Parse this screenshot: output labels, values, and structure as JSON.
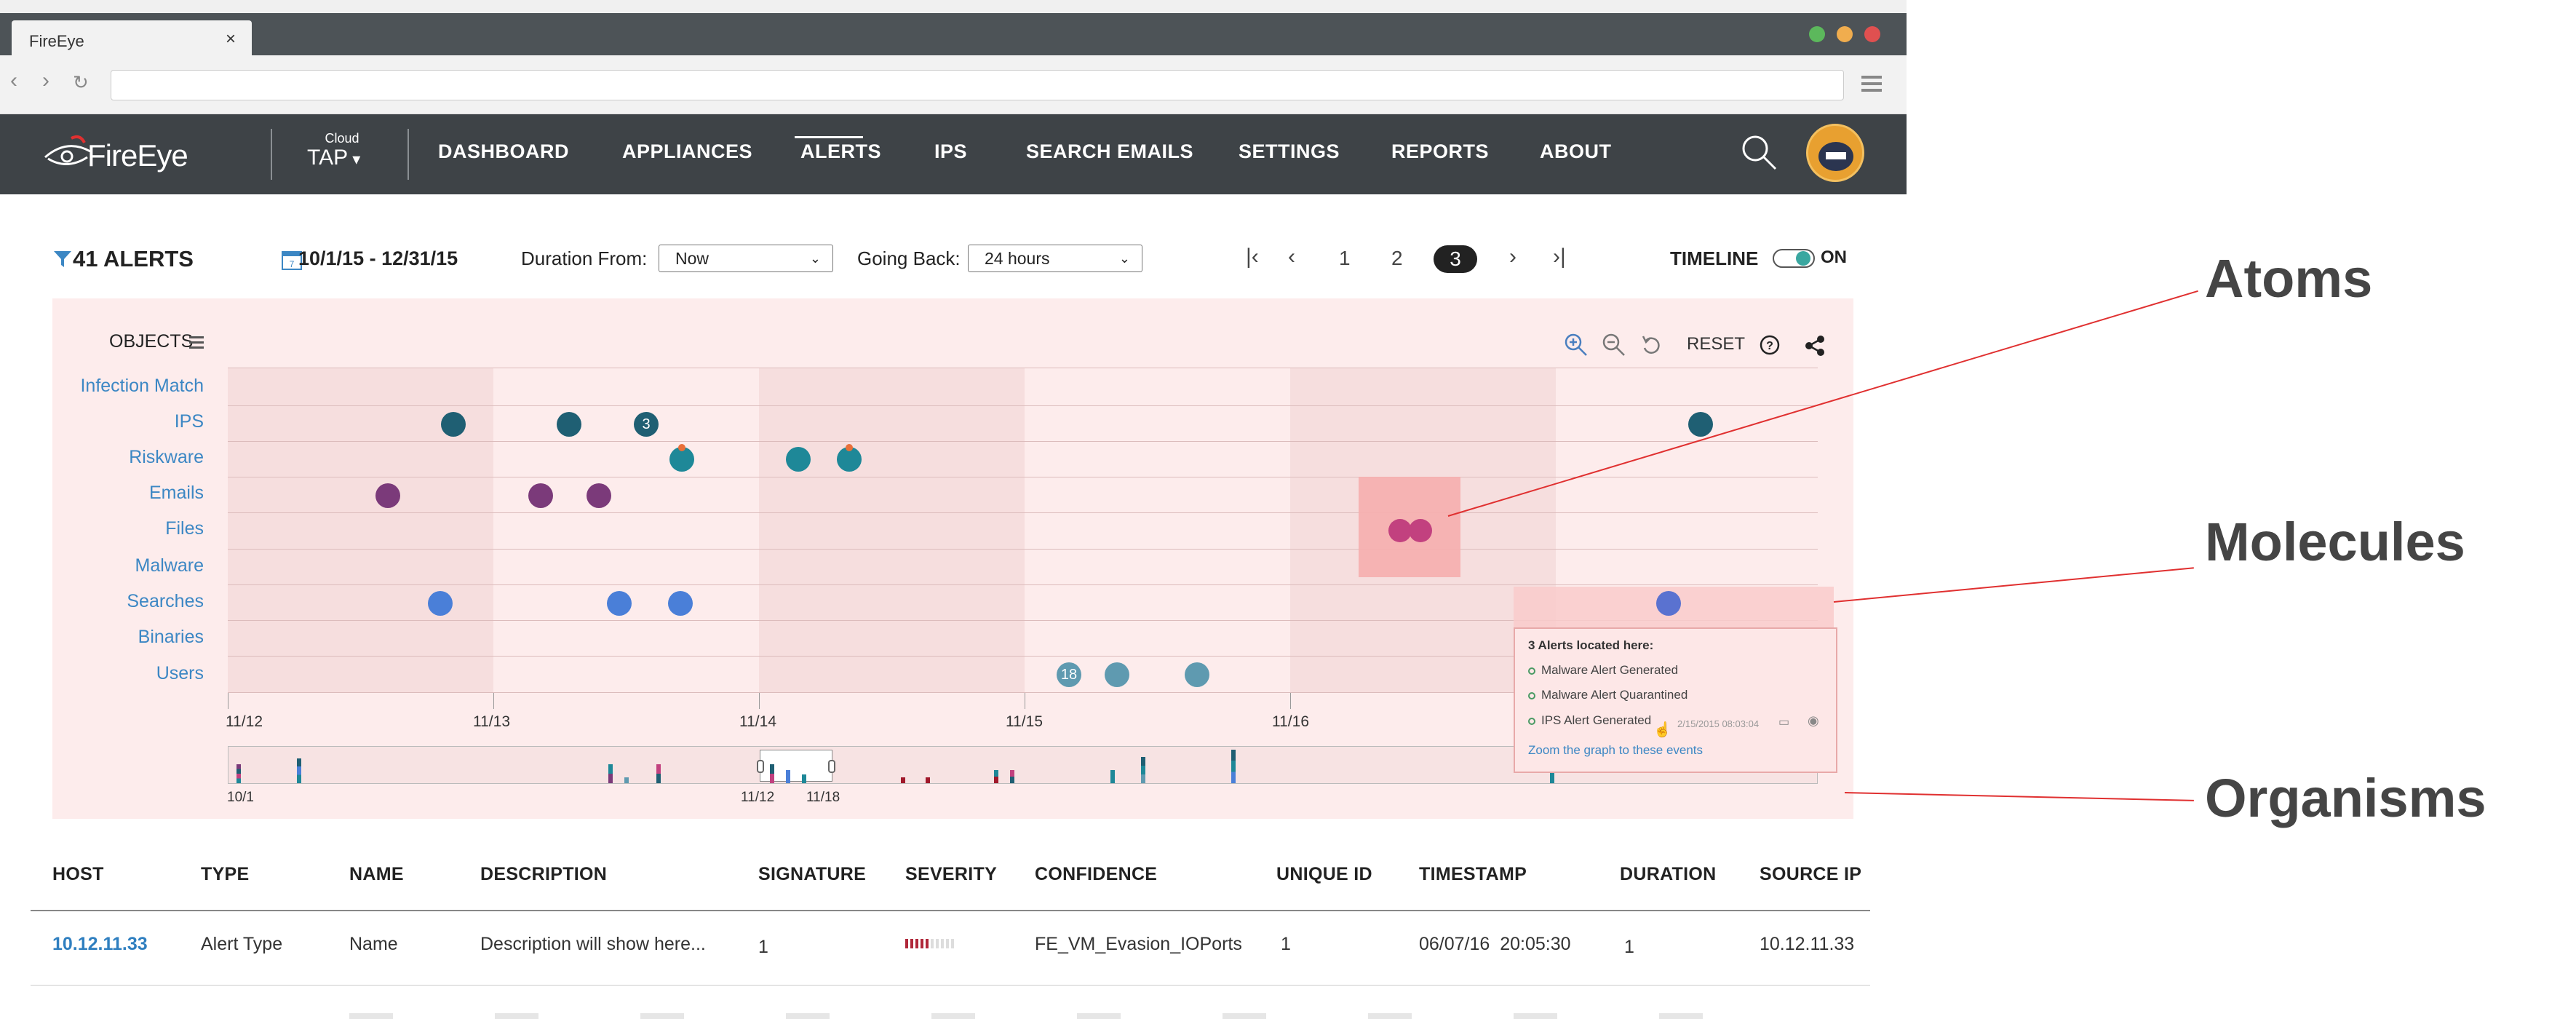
{
  "browser": {
    "tab_title": "FireEye",
    "close_glyph": "×",
    "menu_icon": "hamburger-icon"
  },
  "nav": {
    "logo": "FireEye",
    "cloud_label": "Cloud",
    "tap_label": "TAP",
    "items": [
      "DASHBOARD",
      "APPLIANCES",
      "ALERTS",
      "IPS",
      "SEARCH EMAILS",
      "SETTINGS",
      "REPORTS",
      "ABOUT"
    ],
    "active": "ALERTS"
  },
  "toolbar": {
    "alerts_count": "41 ALERTS",
    "date_range": "10/1/15 - 12/31/15",
    "duration_label": "Duration From:",
    "duration_value": "Now",
    "going_back_label": "Going Back:",
    "going_back_value": "24 hours",
    "pages": [
      "1",
      "2",
      "3"
    ],
    "current_page": "3",
    "timeline_label": "TIMELINE",
    "timeline_state": "ON"
  },
  "timeline": {
    "objects_label": "OBJECTS",
    "reset_label": "RESET",
    "rows": [
      "Infection Match",
      "IPS",
      "Riskware",
      "Emails",
      "Files",
      "Malware",
      "Searches",
      "Binaries",
      "Users"
    ],
    "ticks": [
      "11/12",
      "11/13",
      "11/14",
      "11/15",
      "11/16"
    ],
    "mini_ticks": [
      "10/1",
      "11/12",
      "11/18"
    ],
    "bubble_counts": {
      "ips": "3",
      "users": "18"
    },
    "colors": {
      "ips": "#1f5f73",
      "riskware": "#1e8898",
      "emails": "#7b3a7a",
      "files": "#c2417f",
      "searches": "#4a7fd8",
      "users": "#5f9ab0",
      "accent": "#3c87c4"
    },
    "popup": {
      "title": "3 Alerts located here:",
      "items": [
        "Malware Alert Generated",
        "Malware Alert Quarantined",
        "IPS Alert Generated"
      ],
      "timestamp": "2/15/2015 08:03:04",
      "zoom_link": "Zoom the graph to these events"
    }
  },
  "annotations": [
    "Atoms",
    "Molecules",
    "Organisms"
  ],
  "table": {
    "headers": [
      "HOST",
      "TYPE",
      "NAME",
      "DESCRIPTION",
      "SIGNATURE",
      "SEVERITY",
      "CONFIDENCE",
      "UNIQUE ID",
      "TIMESTAMP",
      "DURATION",
      "SOURCE IP"
    ],
    "rows": [
      {
        "host": "10.12.11.33",
        "type": "Alert Type",
        "name": "Name",
        "description": "Description will show here...",
        "signature": "1",
        "confidence": "FE_VM_Evasion_IOPorts",
        "unique_id": "1",
        "timestamp": "06/07/16  20:05:30",
        "duration": "1",
        "source_ip": "10.12.11.33"
      }
    ]
  }
}
